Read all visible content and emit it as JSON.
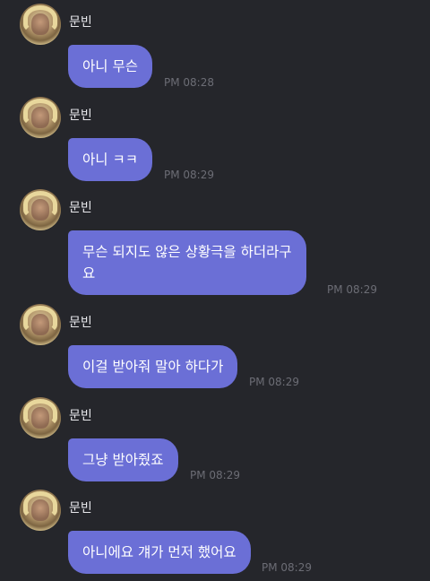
{
  "messages": [
    {
      "sender": "문빈",
      "text": "아니 무슨",
      "time": "PM 08:28"
    },
    {
      "sender": "문빈",
      "text": "아니 ㅋㅋ",
      "time": "PM 08:29"
    },
    {
      "sender": "문빈",
      "text": "무슨 되지도 않은 상황극을 하더라구\n요",
      "time": "PM 08:29"
    },
    {
      "sender": "문빈",
      "text": "이걸 받아줘 말아 하다가",
      "time": "PM 08:29"
    },
    {
      "sender": "문빈",
      "text": "그냥 받아줬죠",
      "time": "PM 08:29"
    },
    {
      "sender": "문빈",
      "text": "아니에요 걔가 먼저 했어요",
      "time": "PM 08:29"
    }
  ],
  "colors": {
    "background": "#25262b",
    "bubble": "#6b6fd6",
    "time": "#6c6d75",
    "name": "#e8e8ec"
  }
}
